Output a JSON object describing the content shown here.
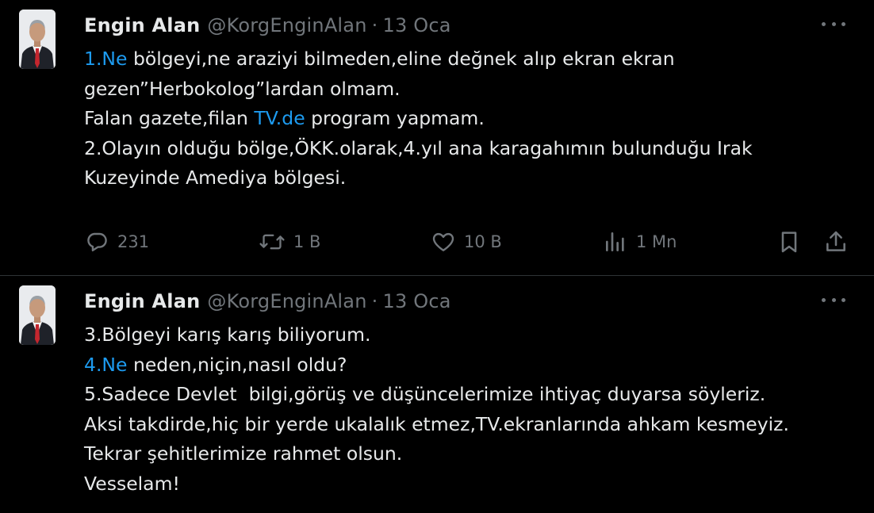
{
  "tweets": [
    {
      "author": {
        "name": "Engin Alan",
        "handle": "@KorgEnginAlan",
        "separator": "·",
        "date": "13 Oca"
      },
      "body_lines": [
        [
          {
            "text": "1.Ne",
            "link": true
          },
          {
            "text": " bölgeyi,ne araziyi bilmeden,eline değnek alıp ekran ekran",
            "link": false
          }
        ],
        [
          {
            "text": "gezen”Herbokolog”lardan olmam.",
            "link": false
          }
        ],
        [
          {
            "text": "Falan gazete,filan ",
            "link": false
          },
          {
            "text": "TV.de",
            "link": true
          },
          {
            "text": " program yapmam.",
            "link": false
          }
        ],
        [
          {
            "text": "2.Olayın olduğu bölge,ÖKK.olarak,4.yıl ana karagahımın bulunduğu Irak",
            "link": false
          }
        ],
        [
          {
            "text": "Kuzeyinde Amediya bölgesi.",
            "link": false
          }
        ]
      ],
      "actions": {
        "replies": "231",
        "retweets": "1 B",
        "likes": "10 B",
        "views": "1 Mn"
      }
    },
    {
      "author": {
        "name": "Engin Alan",
        "handle": "@KorgEnginAlan",
        "separator": "·",
        "date": "13 Oca"
      },
      "body_lines": [
        [
          {
            "text": "3.Bölgeyi karış karış biliyorum.",
            "link": false
          }
        ],
        [
          {
            "text": "4.Ne",
            "link": true
          },
          {
            "text": " neden,niçin,nasıl oldu?",
            "link": false
          }
        ],
        [
          {
            "text": "5.Sadece Devlet  bilgi,görüş ve düşüncelerimize ihtiyaç duyarsa söyleriz.",
            "link": false
          }
        ],
        [
          {
            "text": "Aksi takdirde,hiç bir yerde ukalalık etmez,TV.ekranlarında ahkam kesmeyiz.",
            "link": false
          }
        ],
        [
          {
            "text": "Tekrar şehitlerimize rahmet olsun.",
            "link": false
          }
        ],
        [
          {
            "text": "Vesselam!",
            "link": false
          }
        ]
      ]
    }
  ],
  "icons": {
    "reply": "reply-icon",
    "retweet": "retweet-icon",
    "like": "heart-icon",
    "views": "views-icon",
    "bookmark": "bookmark-icon",
    "share": "share-icon",
    "more": "more-dots-icon"
  },
  "colors": {
    "background": "#000000",
    "text": "#e7e9ea",
    "muted": "#71767b",
    "link": "#1d9bf0",
    "divider": "#2f3336"
  }
}
